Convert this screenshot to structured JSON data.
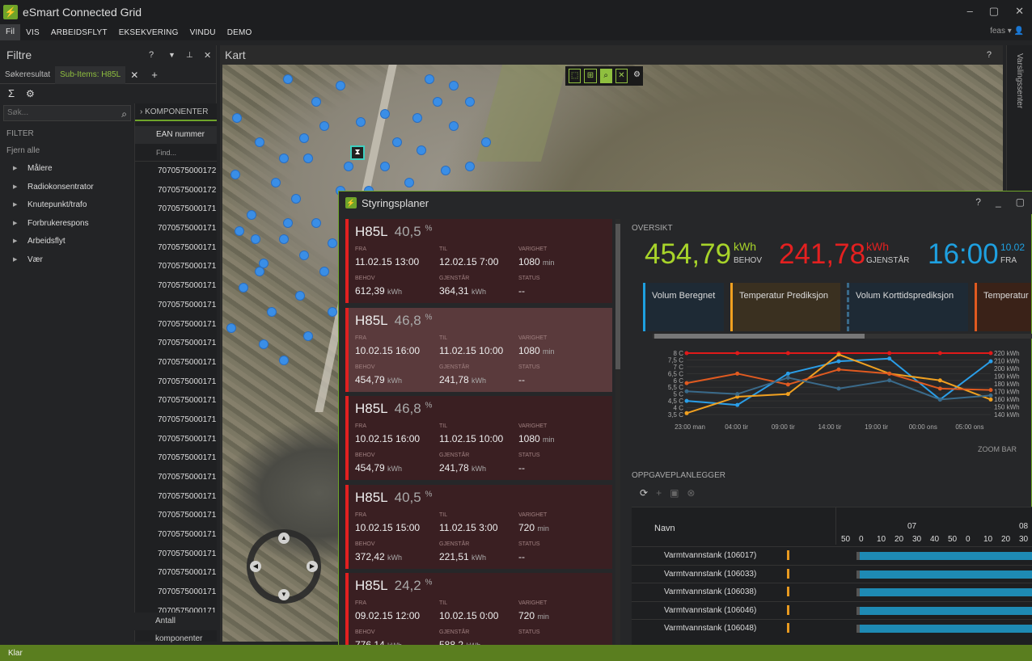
{
  "app": {
    "title": "eSmart Connected Grid",
    "user": "feas"
  },
  "menu": [
    "Fil",
    "VIS",
    "ARBEIDSFLYT",
    "EKSEKVERING",
    "VINDU",
    "DEMO"
  ],
  "filter_panel": {
    "title": "Filtre",
    "tabs": [
      "Søkeresultat",
      "Sub-Items: H85L"
    ],
    "search_placeholder": "Søk...",
    "filter_label": "FILTER",
    "clear_label": "Fjern alle",
    "items": [
      "Målere",
      "Radiokonsentrator",
      "Knutepunkt/trafo",
      "Forbrukerespons",
      "Arbeidsflyt",
      "Vær"
    ]
  },
  "components": {
    "header": "KOMPONENTER",
    "column": "EAN nummer",
    "find": "Find...",
    "rows": [
      "7070575000172",
      "7070575000172",
      "7070575000171",
      "7070575000171",
      "7070575000171",
      "7070575000171",
      "7070575000171",
      "7070575000171",
      "7070575000171",
      "7070575000171",
      "7070575000171",
      "7070575000171",
      "7070575000171",
      "7070575000171",
      "7070575000171",
      "7070575000171",
      "7070575000171",
      "7070575000171",
      "7070575000171",
      "7070575000171",
      "7070575000171",
      "7070575000171",
      "7070575000171",
      "7070575000171"
    ],
    "footer": "Antall komponenter"
  },
  "map": {
    "title": "Kart",
    "side_tab": "Varslingssenter"
  },
  "styringsplaner": {
    "title": "Styringsplaner",
    "plans": [
      {
        "name": "H85L",
        "pct": "40,5",
        "fra": "11.02.15 13:00",
        "til": "12.02.15 7:00",
        "varighet": "1080",
        "varighet_unit": "min",
        "behov": "612,39",
        "gjenstar": "364,31",
        "status": "--"
      },
      {
        "name": "H85L",
        "pct": "46,8",
        "fra": "10.02.15 16:00",
        "til": "11.02.15 10:00",
        "varighet": "1080",
        "varighet_unit": "min",
        "behov": "454,79",
        "gjenstar": "241,78",
        "status": "--"
      },
      {
        "name": "H85L",
        "pct": "46,8",
        "fra": "10.02.15 16:00",
        "til": "11.02.15 10:00",
        "varighet": "1080",
        "varighet_unit": "min",
        "behov": "454,79",
        "gjenstar": "241,78",
        "status": "--"
      },
      {
        "name": "H85L",
        "pct": "40,5",
        "fra": "10.02.15 15:00",
        "til": "11.02.15 3:00",
        "varighet": "720",
        "varighet_unit": "min",
        "behov": "372,42",
        "gjenstar": "221,51",
        "status": "--"
      },
      {
        "name": "H85L",
        "pct": "24,2",
        "fra": "09.02.15 12:00",
        "til": "10.02.15 0:00",
        "varighet": "720",
        "varighet_unit": "min",
        "behov": "776,14",
        "gjenstar": "588,2",
        "status": "--"
      }
    ],
    "labels": {
      "fra": "FRA",
      "til": "TIL",
      "varighet": "VARIGHET",
      "behov": "BEHOV",
      "gjenstar": "GJENSTÅR",
      "status": "STATUS",
      "kwh": "kWh",
      "pct_sign": "%"
    },
    "oversikt": {
      "title": "OVERSIKT",
      "behov_value": "454,79",
      "behov_unit": "kWh",
      "behov_label": "BEHOV",
      "gjenstar_value": "241,78",
      "gjenstar_unit": "kWh",
      "gjenstar_label": "GJENSTÅR",
      "fra_value": "16:00",
      "fra_date": "10.02",
      "fra_label": "FRA",
      "categories": [
        "Volum Beregnet",
        "Temperatur Prediksjon",
        "Volum Korttidsprediksjon",
        "Temperatur Observasjon"
      ],
      "category_colors": [
        "#1ea0e0",
        "#f0a020",
        "#3a6a8a",
        "#e05a20"
      ],
      "zoom": "ZOOM BAR"
    },
    "chart_data": {
      "type": "line",
      "x": [
        "23:00 man",
        "04:00 tir",
        "09:00 tir",
        "14:00 tir",
        "19:00 tir",
        "00:00 ons",
        "05:00 ons"
      ],
      "y_left_ticks": [
        "8 C",
        "7,5 C",
        "7 C",
        "6,5 C",
        "6 C",
        "5,5 C",
        "5 C",
        "4,5 C",
        "4 C",
        "3,5 C"
      ],
      "y_right_ticks": [
        "220 kWh",
        "210 kWh",
        "200 kWh",
        "190 kWh",
        "180 kWh",
        "170 kWh",
        "160 kWh",
        "150 kWh",
        "140 kWh"
      ],
      "series": [
        {
          "color": "#e01a1a",
          "values": [
            8.0,
            8.0,
            8.0,
            8.0,
            8.0,
            8.0,
            8.0
          ]
        },
        {
          "color": "#2a9ee8",
          "values": [
            4.5,
            4.2,
            6.5,
            7.4,
            7.6,
            4.6,
            7.4
          ]
        },
        {
          "color": "#f0a020",
          "values": [
            3.6,
            4.8,
            5.0,
            7.9,
            6.5,
            6.0,
            4.6
          ]
        },
        {
          "color": "#e05a20",
          "values": [
            5.8,
            6.5,
            5.7,
            6.8,
            6.5,
            5.4,
            5.3
          ]
        },
        {
          "color": "#3a6a8a",
          "values": [
            5.2,
            5.0,
            6.2,
            5.4,
            6.0,
            4.6,
            4.9
          ]
        }
      ]
    },
    "planner": {
      "title": "OPPGAVEPLANLEGGER",
      "column": "Navn",
      "day1": "07",
      "day2": "08",
      "minutes": [
        "50",
        "0",
        "10",
        "20",
        "30",
        "40",
        "50",
        "0",
        "10",
        "20",
        "30"
      ],
      "rows": [
        "Varmtvannstank (106017)",
        "Varmtvannstank (106033)",
        "Varmtvannstank (106038)",
        "Varmtvannstank (106046)",
        "Varmtvannstank (106048)"
      ]
    }
  },
  "status": "Klar"
}
